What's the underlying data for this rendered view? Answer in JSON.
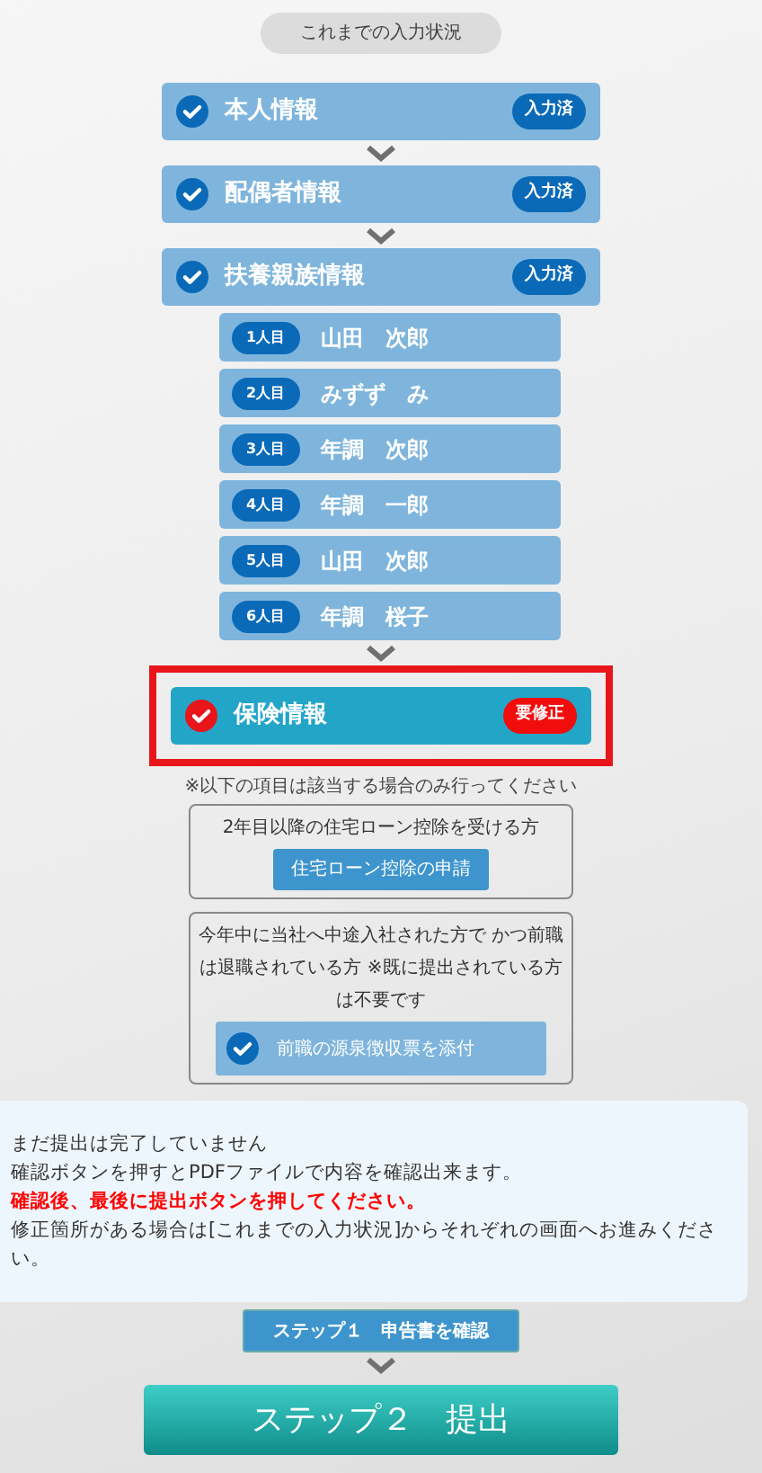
{
  "status_heading": "これまでの入力状況",
  "sections": [
    {
      "title": "本人情報",
      "kind": "done",
      "badge": "入力済",
      "highlighted": false
    },
    {
      "title": "配偶者情報",
      "kind": "done",
      "badge": "入力済",
      "highlighted": false
    },
    {
      "title": "扶養親族情報",
      "kind": "done",
      "badge": "入力済",
      "highlighted": false,
      "people": [
        {
          "ordinal": "1人目",
          "name": "山田　次郎"
        },
        {
          "ordinal": "2人目",
          "name": "みずず　み"
        },
        {
          "ordinal": "3人目",
          "name": "年調　次郎"
        },
        {
          "ordinal": "4人目",
          "name": "年調　一郎"
        },
        {
          "ordinal": "5人目",
          "name": "山田　次郎"
        },
        {
          "ordinal": "6人目",
          "name": "年調　桜子"
        }
      ]
    },
    {
      "title": "保険情報",
      "kind": "fix",
      "badge": "要修正",
      "highlighted": true
    }
  ],
  "optional_note": "※以下の項目は該当する場合のみ行ってください",
  "optional_items": [
    {
      "kind": "plain",
      "description": "2年目以降の住宅ローン控除を受ける方",
      "button": "住宅ローン控除の申請"
    },
    {
      "kind": "check",
      "description": "今年中に当社へ中途入社された方で かつ前職は退職されている方 ※既に提出されている方は不要です",
      "button": "前職の源泉徴収票を添付"
    }
  ],
  "notice": [
    {
      "kind": "normal",
      "text": "まだ提出は完了していません"
    },
    {
      "kind": "normal",
      "text": "確認ボタンを押すとPDFファイルで内容を確認出来ます。"
    },
    {
      "kind": "warning",
      "text": "確認後、最後に提出ボタンを押してください。"
    },
    {
      "kind": "normal",
      "text": "修正箇所がある場合は[これまでの入力状況]からそれぞれの画面へお進みください。"
    }
  ],
  "step1_button": "ステップ１　申告書を確認",
  "step2_button": "ステップ２　提出"
}
